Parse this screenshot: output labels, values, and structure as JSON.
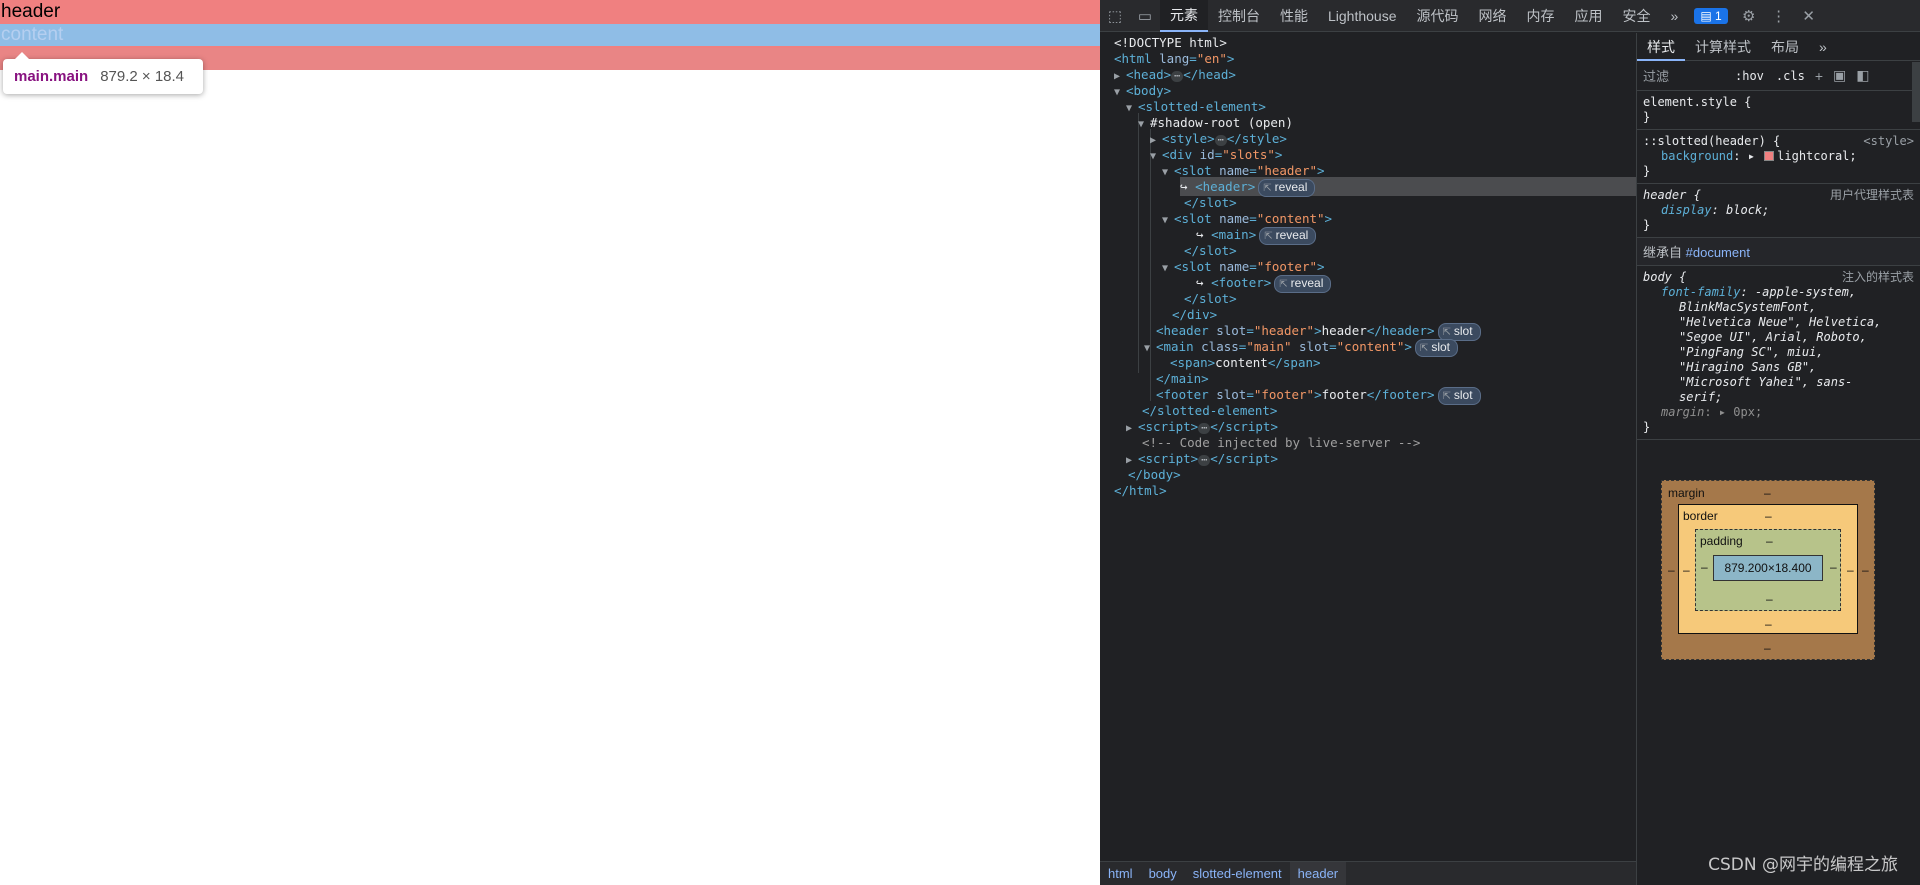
{
  "preview": {
    "header_text": "header",
    "content_text": "content",
    "tooltip": {
      "name": "main.main",
      "size": "879.2 × 18.4"
    },
    "colors": {
      "header_bg": "#f08080",
      "main_overlay": "#8fbde6"
    }
  },
  "toolbar": {
    "inspect_icon": "inspect-cursor-icon",
    "device_icon": "device-toolbar-icon",
    "tabs": [
      "元素",
      "控制台",
      "性能",
      "Lighthouse",
      "源代码",
      "网络",
      "内存",
      "应用",
      "安全"
    ],
    "more": "»",
    "issues_count": "1",
    "settings_icon": "gear-icon",
    "menu_icon": "kebab-icon",
    "close_icon": "close-icon"
  },
  "elements": {
    "doctype": "<!DOCTYPE html>",
    "comment": "<!-- Code injected by live-server -->",
    "header_text": "header",
    "content_text": "content",
    "footer_text": "footer",
    "reveal": "reveal",
    "slot": "slot",
    "shadow_root": "#shadow-root (open)"
  },
  "breadcrumb": [
    "html",
    "body",
    "slotted-element",
    "header"
  ],
  "styles": {
    "tabs": [
      "样式",
      "计算样式",
      "布局",
      "»"
    ],
    "filter_placeholder": "过滤",
    "hov": ":hov",
    "cls": ".cls",
    "element_style": "element.style {",
    "rule1_selector": "::slotted(header) {",
    "rule1_source": "<style>",
    "rule1_prop": "background",
    "rule1_value": "lightcoral;",
    "rule2_selector": "header {",
    "rule2_source": "用户代理样式表",
    "rule2_prop": "display",
    "rule2_value": "block;",
    "inherited_label": "继承自",
    "inherited_link": "#document",
    "rule3_selector": "body {",
    "rule3_source": "注入的样式表",
    "rule3_prop": "font-family",
    "rule3_value_lines": [
      "-apple-system,",
      "BlinkMacSystemFont,",
      "\"Helvetica Neue\", Helvetica,",
      "\"Segoe UI\", Arial, Roboto,",
      "\"PingFang SC\", miui,",
      "\"Hiragino Sans GB\",",
      "\"Microsoft Yahei\", sans-",
      "serif;"
    ],
    "rule3_margin": "margin",
    "rule3_margin_value": "0px;",
    "close_brace": "}"
  },
  "boxmodel": {
    "margin": "margin",
    "border": "border",
    "padding": "padding",
    "content": "879.200×18.400",
    "dash": "–"
  },
  "watermark": "CSDN @网宇的编程之旅"
}
